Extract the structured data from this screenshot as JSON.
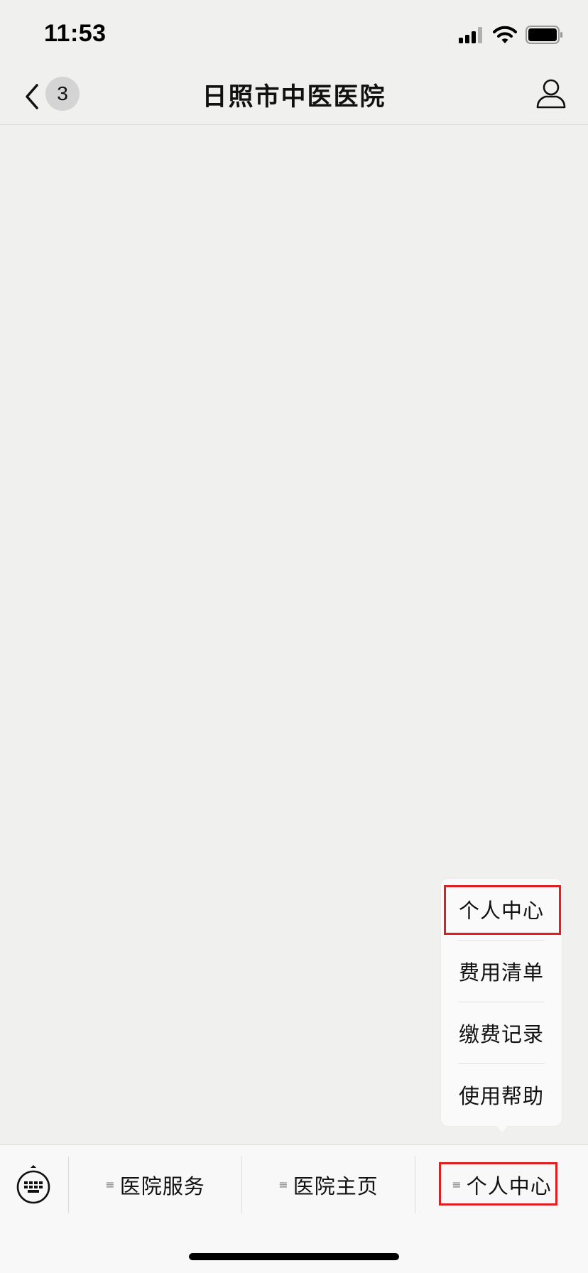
{
  "status_bar": {
    "time": "11:53"
  },
  "nav": {
    "title": "日照市中医医院",
    "badge_count": "3"
  },
  "popup_menu": {
    "items": [
      {
        "label": "个人中心"
      },
      {
        "label": "费用清单"
      },
      {
        "label": "缴费记录"
      },
      {
        "label": "使用帮助"
      }
    ]
  },
  "bottom_menu": {
    "tabs": [
      {
        "label": "医院服务"
      },
      {
        "label": "医院主页"
      },
      {
        "label": "个人中心"
      }
    ]
  },
  "icons": {
    "back": "chevron-left-icon",
    "profile": "person-outline-icon",
    "keyboard": "keyboard-icon",
    "menu_glyph": "menu-lines-icon"
  },
  "colors": {
    "background": "#f0f0ee",
    "highlight": "#e02020",
    "bar_background": "#f8f8f8"
  }
}
